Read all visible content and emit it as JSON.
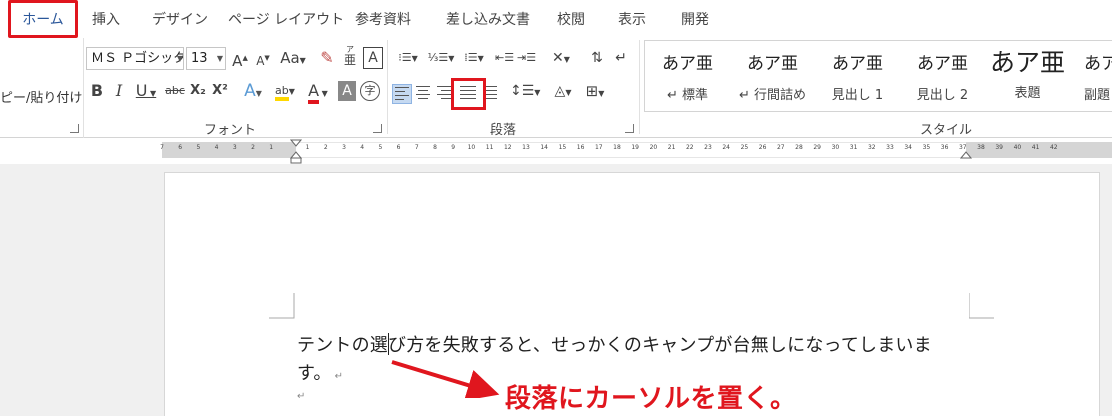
{
  "tabs": {
    "home": "ホーム",
    "insert": "挿入",
    "design": "デザイン",
    "page_layout": "ページ レイアウト",
    "references": "参考資料",
    "mailings": "差し込み文書",
    "review": "校閲",
    "view": "表示",
    "developer": "開発"
  },
  "clipboard": {
    "format_painter_label": "ピー/貼り付け"
  },
  "font_group": {
    "label": "フォント",
    "font_name": "ＭＳ Ｐゴシック",
    "font_size": "13",
    "grow_font": "A",
    "shrink_font": "A",
    "change_case": "Aa",
    "bold": "B",
    "italic": "I",
    "underline": "U",
    "strikethrough": "abc",
    "subscript": "X₂",
    "superscript": "X²",
    "text_effects": "A",
    "highlight": "ab",
    "font_color": "A",
    "char_shading": "A",
    "enclose_char": "字",
    "char_border": "A",
    "phonetic_top": "ア",
    "phonetic_bottom": "亜"
  },
  "paragraph_group": {
    "label": "段落"
  },
  "styles_group": {
    "label": "スタイル",
    "items": [
      {
        "sample": "あア亜",
        "name": "↵ 標準"
      },
      {
        "sample": "あア亜",
        "name": "↵ 行間詰め"
      },
      {
        "sample": "あア亜",
        "name": "見出し 1"
      },
      {
        "sample": "あア亜",
        "name": "見出し 2"
      },
      {
        "sample": "あア亜",
        "name": "表題"
      },
      {
        "sample": "あア",
        "name": "副題"
      }
    ]
  },
  "ruler": {
    "numbers": [
      "7",
      "6",
      "5",
      "4",
      "3",
      "2",
      "1",
      "",
      "1",
      "2",
      "3",
      "4",
      "5",
      "6",
      "7",
      "8",
      "9",
      "10",
      "11",
      "12",
      "13",
      "14",
      "15",
      "16",
      "17",
      "18",
      "19",
      "20",
      "21",
      "22",
      "23",
      "24",
      "25",
      "26",
      "27",
      "28",
      "29",
      "30",
      "31",
      "32",
      "33",
      "34",
      "35",
      "36",
      "37",
      "38",
      "39",
      "40",
      "41",
      "42"
    ]
  },
  "document": {
    "line1": "テントの選び方を失敗すると、せっかくのキャンプが台無しになってしまいま",
    "line2": "す。"
  },
  "annotation": {
    "text": "段落にカーソルを置く。",
    "color": "#e0161e"
  },
  "colors": {
    "accent": "#2b579a",
    "highlight_red": "#e0161e",
    "highlighter_yellow": "#ffd800",
    "font_color_red": "#e0161e"
  }
}
